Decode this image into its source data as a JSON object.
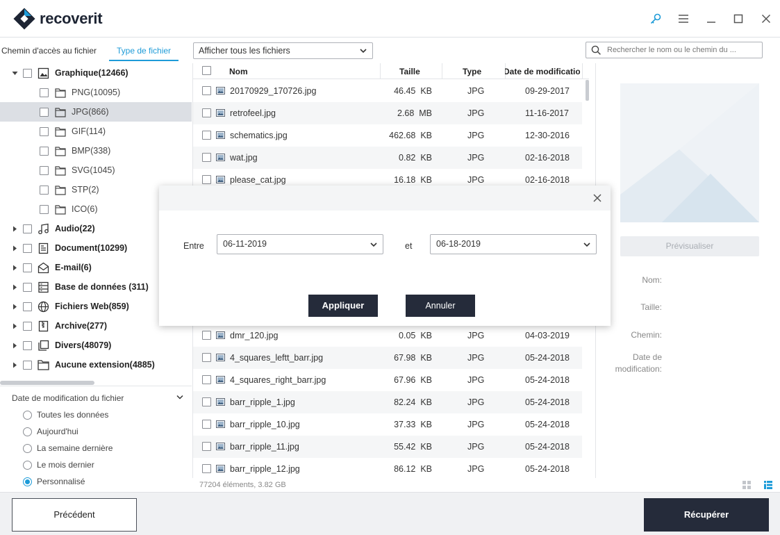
{
  "app": {
    "name": "recoverit"
  },
  "colors": {
    "accent": "#1d9bd8",
    "dark_button": "#252b3a",
    "selected_row": "#dcdfe4"
  },
  "tabs": [
    {
      "label": "Chemin d'accès au fichier"
    },
    {
      "label": "Type de fichier"
    }
  ],
  "filter": {
    "value": "Afficher tous les fichiers"
  },
  "search": {
    "placeholder": "Rechercher le nom ou le chemin du ..."
  },
  "tree": {
    "graphique": "Graphique(12466)",
    "children": [
      "PNG(10095)",
      "JPG(866)",
      "GIF(114)",
      "BMP(338)",
      "SVG(1045)",
      "STP(2)",
      "ICO(6)"
    ],
    "categories": [
      "Audio(22)",
      "Document(10299)",
      "E-mail(6)",
      "Base de données (311)",
      "Fichiers Web(859)",
      "Archive(277)",
      "Divers(48079)",
      "Aucune extension(4885)"
    ],
    "selected": "JPG(866)"
  },
  "date_filter": {
    "title": "Date de modification du fichier",
    "options": [
      "Toutes les données",
      "Aujourd'hui",
      "La semaine dernière",
      "Le mois dernier",
      "Personnalisé"
    ],
    "selected": "Personnalisé"
  },
  "table": {
    "headers": {
      "name": "Nom",
      "size": "Taille",
      "type": "Type",
      "date": "Date de modificatio"
    },
    "rows_top": [
      {
        "name": "20170929_170726.jpg",
        "size": "46.45  KB",
        "type": "JPG",
        "date": "09-29-2017"
      },
      {
        "name": "retrofeel.jpg",
        "size": "2.68  MB",
        "type": "JPG",
        "date": "11-16-2017"
      },
      {
        "name": "schematics.jpg",
        "size": "462.68  KB",
        "type": "JPG",
        "date": "12-30-2016"
      },
      {
        "name": "wat.jpg",
        "size": "0.82  KB",
        "type": "JPG",
        "date": "02-16-2018"
      },
      {
        "name": "please_cat.jpg",
        "size": "16.18  KB",
        "type": "JPG",
        "date": "02-16-2018"
      }
    ],
    "rows_bottom": [
      {
        "name": "dmr_120.jpg",
        "size": "0.05  KB",
        "type": "JPG",
        "date": "04-03-2019"
      },
      {
        "name": "4_squares_leftt_barr.jpg",
        "size": "67.98  KB",
        "type": "JPG",
        "date": "05-24-2018"
      },
      {
        "name": "4_squares_right_barr.jpg",
        "size": "67.96  KB",
        "type": "JPG",
        "date": "05-24-2018"
      },
      {
        "name": "barr_ripple_1.jpg",
        "size": "82.24  KB",
        "type": "JPG",
        "date": "05-24-2018"
      },
      {
        "name": "barr_ripple_10.jpg",
        "size": "37.33  KB",
        "type": "JPG",
        "date": "05-24-2018"
      },
      {
        "name": "barr_ripple_11.jpg",
        "size": "55.42  KB",
        "type": "JPG",
        "date": "05-24-2018"
      },
      {
        "name": "barr_ripple_12.jpg",
        "size": "86.12  KB",
        "type": "JPG",
        "date": "05-24-2018"
      }
    ]
  },
  "status": {
    "text": "77204 éléments, 3.82  GB"
  },
  "preview": {
    "button": "Prévisualiser",
    "labels": {
      "name": "Nom:",
      "size": "Taille:",
      "path": "Chemin:",
      "date_line1": "Date de",
      "date_line2": "modification:"
    }
  },
  "modal": {
    "from_label": "Entre",
    "from_value": "06-11-2019",
    "to_label": "et",
    "to_value": "06-18-2019",
    "apply": "Appliquer",
    "cancel": "Annuler"
  },
  "footer": {
    "previous": "Précédent",
    "recover": "Récupérer"
  }
}
